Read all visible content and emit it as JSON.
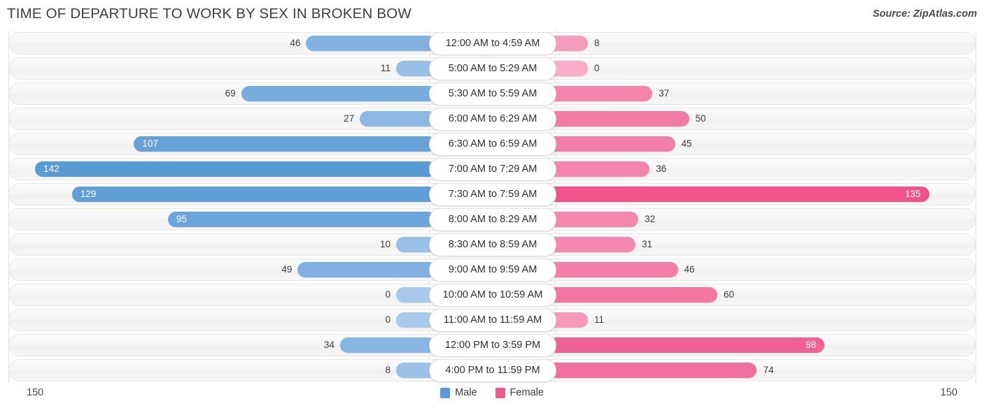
{
  "header": {
    "title": "TIME OF DEPARTURE TO WORK BY SEX IN BROKEN BOW",
    "source": "Source: ZipAtlas.com"
  },
  "legend": {
    "male_label": "Male",
    "female_label": "Female",
    "male_color": "#5B9BD5",
    "female_color": "#EC5C8D"
  },
  "axis": {
    "left_label": "150",
    "right_label": "150",
    "max": 150
  },
  "chart_data": {
    "type": "bar",
    "orientation": "horizontal-diverging",
    "title": "TIME OF DEPARTURE TO WORK BY SEX IN BROKEN BOW",
    "xlabel": "",
    "ylabel": "",
    "xlim": [
      150,
      150
    ],
    "grid": false,
    "legend_position": "bottom-center",
    "categories": [
      "12:00 AM to 4:59 AM",
      "5:00 AM to 5:29 AM",
      "5:30 AM to 5:59 AM",
      "6:00 AM to 6:29 AM",
      "6:30 AM to 6:59 AM",
      "7:00 AM to 7:29 AM",
      "7:30 AM to 7:59 AM",
      "8:00 AM to 8:29 AM",
      "8:30 AM to 8:59 AM",
      "9:00 AM to 9:59 AM",
      "10:00 AM to 10:59 AM",
      "11:00 AM to 11:59 AM",
      "12:00 PM to 3:59 PM",
      "4:00 PM to 11:59 PM"
    ],
    "series": [
      {
        "name": "Male",
        "color": "#5B9BD5",
        "values": [
          46,
          11,
          69,
          27,
          107,
          142,
          129,
          95,
          10,
          49,
          0,
          0,
          34,
          8
        ]
      },
      {
        "name": "Female",
        "color": "#EC5C8D",
        "values": [
          8,
          0,
          37,
          50,
          45,
          36,
          135,
          32,
          31,
          46,
          60,
          11,
          98,
          74
        ]
      }
    ]
  }
}
